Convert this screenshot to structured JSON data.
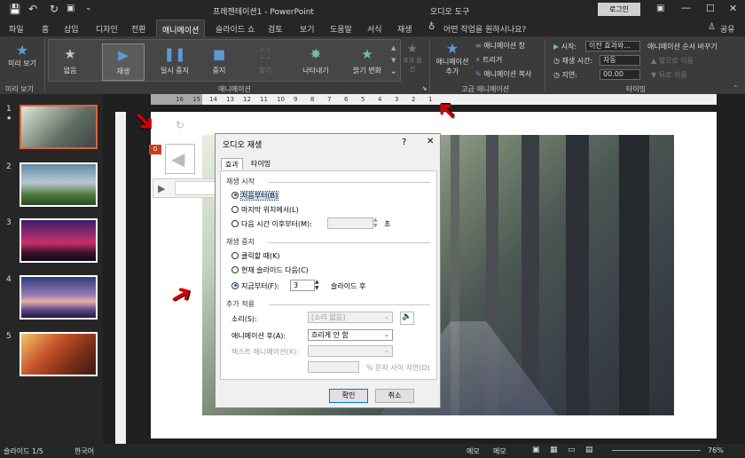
{
  "window": {
    "title": "프레젠테이션1 - PowerPoint",
    "context_title": "오디오 도구",
    "login": "로그인"
  },
  "tabs": [
    "파일",
    "홈",
    "삽입",
    "디자인",
    "전환",
    "애니메이션",
    "슬라이드 쇼",
    "검토",
    "보기",
    "도움말",
    "서식",
    "재생"
  ],
  "tell_me": "어떤 작업을 원하시나요?",
  "share": "공유",
  "ribbon": {
    "preview_label": "미리 보기",
    "preview_group": "미리 보기",
    "animation_group": "애니메이션",
    "effects": [
      {
        "label": "없음",
        "icon": "star-outline-icon",
        "color": "#c8c8c8"
      },
      {
        "label": "재생",
        "icon": "play-icon",
        "color": "#5b9bd5"
      },
      {
        "label": "일시 중지",
        "icon": "pause-icon",
        "color": "#5b9bd5"
      },
      {
        "label": "중지",
        "icon": "stop-icon",
        "color": "#5b9bd5"
      },
      {
        "label": "찾기",
        "icon": "camera-icon",
        "color": "#6f6f6f"
      },
      {
        "label": "나타내기",
        "icon": "burst-icon",
        "color": "#6fc1a0"
      },
      {
        "label": "밝기 변화",
        "icon": "star-icon",
        "color": "#6fc1a0"
      }
    ],
    "effect_options": "효과 옵션",
    "advanced_group": "고급 애니메이션",
    "add_animation": "애니메이션 추가",
    "animation_pane": "애니메이션 창",
    "trigger": "트리거",
    "animation_painter": "애니메이션 복사",
    "timing_group": "타이밍",
    "start_label": "시작:",
    "start_value": "이전 효과와...",
    "duration_label": "재생 시간:",
    "duration_value": "자동",
    "delay_label": "지연:",
    "delay_value": "00.00",
    "reorder_title": "애니메이션 순서 바꾸기",
    "move_earlier": "앞으로 이동",
    "move_later": "뒤로 이동"
  },
  "ruler": {
    "top_ticks": [
      "16",
      "15",
      "14",
      "13",
      "12",
      "11",
      "10",
      "9",
      "8",
      "7",
      "6",
      "5",
      "4",
      "3",
      "2",
      "1"
    ]
  },
  "slides": [
    {
      "num": "1"
    },
    {
      "num": "2"
    },
    {
      "num": "3"
    },
    {
      "num": "4"
    },
    {
      "num": "5"
    }
  ],
  "slide_star": "★",
  "audio_badge": "0",
  "dialog": {
    "title": "오디오 재생",
    "help": "?",
    "close": "✕",
    "tab_effect": "효과",
    "tab_timing": "타이밍",
    "start_section": "재생 시작",
    "opt_from_beginning": "처음부터(B)",
    "opt_from_last": "마지막 위치에서(L)",
    "opt_from_time": "다음 시간 이후부터(M):",
    "seconds": "초",
    "stop_section": "재생 중지",
    "opt_on_click": "클릭할 때(K)",
    "opt_after_current": "현재 슬라이드 다음(C)",
    "opt_after_slides": "지금부터(F):",
    "slides_value": "3",
    "slides_after": "슬라이드 후",
    "enhance_section": "추가 적용",
    "sound_label": "소리(S):",
    "sound_value": "[소리 없음]",
    "after_anim_label": "애니메이션 후(A):",
    "after_anim_value": "흐리게 안 함",
    "text_anim_label": "텍스트 애니메이션(X):",
    "delay_between": "% 문자 사이 지연(D)",
    "ok": "확인",
    "cancel": "취소"
  },
  "status": {
    "slide_info": "슬라이드 1/5",
    "language": "한국어",
    "notes": "메모",
    "comments": "메모",
    "zoom": "76%"
  }
}
